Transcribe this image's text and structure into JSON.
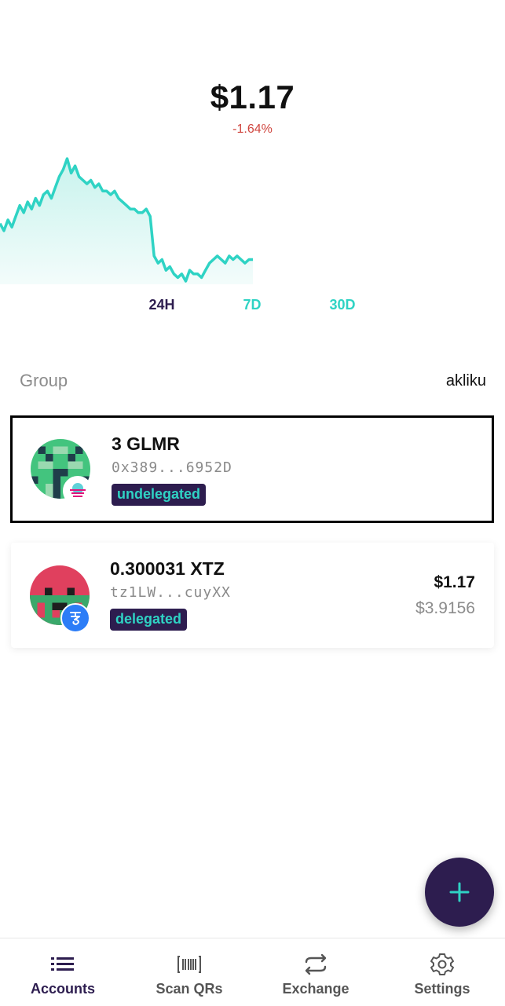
{
  "balance": {
    "amount": "$1.17",
    "change": "-1.64%"
  },
  "chart_data": {
    "type": "area",
    "x": [
      0,
      1,
      2,
      3,
      4,
      5,
      6,
      7,
      8,
      9,
      10,
      11,
      12,
      13,
      14,
      15,
      16,
      17,
      18,
      19,
      20,
      21,
      22,
      23,
      24,
      25,
      26,
      27,
      28,
      29,
      30,
      31,
      32,
      33,
      34,
      35,
      36,
      37,
      38,
      39,
      40,
      41,
      42,
      43,
      44,
      45,
      46,
      47,
      48,
      49,
      50,
      51,
      52,
      53,
      54,
      55,
      56,
      57,
      58,
      59,
      60,
      61,
      62,
      63,
      64
    ],
    "values": [
      1.27,
      1.25,
      1.28,
      1.26,
      1.29,
      1.32,
      1.3,
      1.33,
      1.31,
      1.34,
      1.32,
      1.35,
      1.36,
      1.34,
      1.37,
      1.4,
      1.42,
      1.45,
      1.41,
      1.43,
      1.4,
      1.39,
      1.38,
      1.39,
      1.37,
      1.38,
      1.36,
      1.36,
      1.35,
      1.36,
      1.34,
      1.33,
      1.32,
      1.31,
      1.31,
      1.3,
      1.3,
      1.31,
      1.29,
      1.18,
      1.16,
      1.17,
      1.14,
      1.15,
      1.13,
      1.12,
      1.13,
      1.11,
      1.14,
      1.13,
      1.13,
      1.12,
      1.14,
      1.16,
      1.17,
      1.18,
      1.17,
      1.16,
      1.18,
      1.17,
      1.18,
      1.17,
      1.16,
      1.17,
      1.17
    ],
    "line_color": "#2fd3c4",
    "fill_color": "#e6f9f6"
  },
  "ranges": [
    {
      "label": "24H",
      "active": true
    },
    {
      "label": "7D",
      "active": false
    },
    {
      "label": "30D",
      "active": false
    }
  ],
  "group": {
    "label": "Group",
    "value": "akliku"
  },
  "accounts": [
    {
      "title": "3 GLMR",
      "address": "0x389...6952D",
      "tag": "undelegated",
      "fiat": "",
      "price": "",
      "chain_icon": "moonbeam-icon"
    },
    {
      "title": "0.300031 XTZ",
      "address": "tz1LW...cuyXX",
      "tag": "delegated",
      "fiat": "$1.17",
      "price": "$3.9156",
      "chain_icon": "tezos-icon"
    }
  ],
  "fab": {
    "icon": "plus-icon"
  },
  "tabs": [
    {
      "label": "Accounts",
      "icon": "list-icon",
      "active": true
    },
    {
      "label": "Scan QRs",
      "icon": "barcode-icon",
      "active": false
    },
    {
      "label": "Exchange",
      "icon": "exchange-icon",
      "active": false
    },
    {
      "label": "Settings",
      "icon": "gear-icon",
      "active": false
    }
  ],
  "colors": {
    "brand_dark": "#2d1d4f",
    "accent": "#2fd3c4",
    "negative": "#d0463f"
  }
}
